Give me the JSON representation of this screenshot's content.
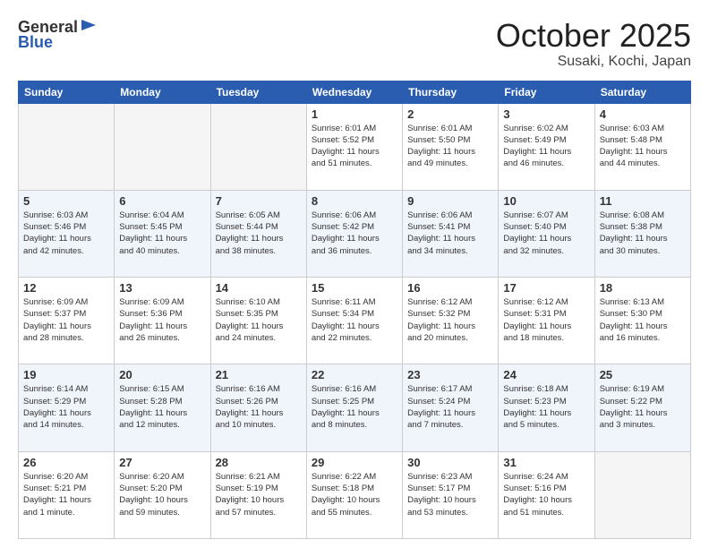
{
  "header": {
    "logo_general": "General",
    "logo_blue": "Blue",
    "month_title": "October 2025",
    "location": "Susaki, Kochi, Japan"
  },
  "weekdays": [
    "Sunday",
    "Monday",
    "Tuesday",
    "Wednesday",
    "Thursday",
    "Friday",
    "Saturday"
  ],
  "weeks": [
    [
      {
        "day": "",
        "info": ""
      },
      {
        "day": "",
        "info": ""
      },
      {
        "day": "",
        "info": ""
      },
      {
        "day": "1",
        "info": "Sunrise: 6:01 AM\nSunset: 5:52 PM\nDaylight: 11 hours\nand 51 minutes."
      },
      {
        "day": "2",
        "info": "Sunrise: 6:01 AM\nSunset: 5:50 PM\nDaylight: 11 hours\nand 49 minutes."
      },
      {
        "day": "3",
        "info": "Sunrise: 6:02 AM\nSunset: 5:49 PM\nDaylight: 11 hours\nand 46 minutes."
      },
      {
        "day": "4",
        "info": "Sunrise: 6:03 AM\nSunset: 5:48 PM\nDaylight: 11 hours\nand 44 minutes."
      }
    ],
    [
      {
        "day": "5",
        "info": "Sunrise: 6:03 AM\nSunset: 5:46 PM\nDaylight: 11 hours\nand 42 minutes."
      },
      {
        "day": "6",
        "info": "Sunrise: 6:04 AM\nSunset: 5:45 PM\nDaylight: 11 hours\nand 40 minutes."
      },
      {
        "day": "7",
        "info": "Sunrise: 6:05 AM\nSunset: 5:44 PM\nDaylight: 11 hours\nand 38 minutes."
      },
      {
        "day": "8",
        "info": "Sunrise: 6:06 AM\nSunset: 5:42 PM\nDaylight: 11 hours\nand 36 minutes."
      },
      {
        "day": "9",
        "info": "Sunrise: 6:06 AM\nSunset: 5:41 PM\nDaylight: 11 hours\nand 34 minutes."
      },
      {
        "day": "10",
        "info": "Sunrise: 6:07 AM\nSunset: 5:40 PM\nDaylight: 11 hours\nand 32 minutes."
      },
      {
        "day": "11",
        "info": "Sunrise: 6:08 AM\nSunset: 5:38 PM\nDaylight: 11 hours\nand 30 minutes."
      }
    ],
    [
      {
        "day": "12",
        "info": "Sunrise: 6:09 AM\nSunset: 5:37 PM\nDaylight: 11 hours\nand 28 minutes."
      },
      {
        "day": "13",
        "info": "Sunrise: 6:09 AM\nSunset: 5:36 PM\nDaylight: 11 hours\nand 26 minutes."
      },
      {
        "day": "14",
        "info": "Sunrise: 6:10 AM\nSunset: 5:35 PM\nDaylight: 11 hours\nand 24 minutes."
      },
      {
        "day": "15",
        "info": "Sunrise: 6:11 AM\nSunset: 5:34 PM\nDaylight: 11 hours\nand 22 minutes."
      },
      {
        "day": "16",
        "info": "Sunrise: 6:12 AM\nSunset: 5:32 PM\nDaylight: 11 hours\nand 20 minutes."
      },
      {
        "day": "17",
        "info": "Sunrise: 6:12 AM\nSunset: 5:31 PM\nDaylight: 11 hours\nand 18 minutes."
      },
      {
        "day": "18",
        "info": "Sunrise: 6:13 AM\nSunset: 5:30 PM\nDaylight: 11 hours\nand 16 minutes."
      }
    ],
    [
      {
        "day": "19",
        "info": "Sunrise: 6:14 AM\nSunset: 5:29 PM\nDaylight: 11 hours\nand 14 minutes."
      },
      {
        "day": "20",
        "info": "Sunrise: 6:15 AM\nSunset: 5:28 PM\nDaylight: 11 hours\nand 12 minutes."
      },
      {
        "day": "21",
        "info": "Sunrise: 6:16 AM\nSunset: 5:26 PM\nDaylight: 11 hours\nand 10 minutes."
      },
      {
        "day": "22",
        "info": "Sunrise: 6:16 AM\nSunset: 5:25 PM\nDaylight: 11 hours\nand 8 minutes."
      },
      {
        "day": "23",
        "info": "Sunrise: 6:17 AM\nSunset: 5:24 PM\nDaylight: 11 hours\nand 7 minutes."
      },
      {
        "day": "24",
        "info": "Sunrise: 6:18 AM\nSunset: 5:23 PM\nDaylight: 11 hours\nand 5 minutes."
      },
      {
        "day": "25",
        "info": "Sunrise: 6:19 AM\nSunset: 5:22 PM\nDaylight: 11 hours\nand 3 minutes."
      }
    ],
    [
      {
        "day": "26",
        "info": "Sunrise: 6:20 AM\nSunset: 5:21 PM\nDaylight: 11 hours\nand 1 minute."
      },
      {
        "day": "27",
        "info": "Sunrise: 6:20 AM\nSunset: 5:20 PM\nDaylight: 10 hours\nand 59 minutes."
      },
      {
        "day": "28",
        "info": "Sunrise: 6:21 AM\nSunset: 5:19 PM\nDaylight: 10 hours\nand 57 minutes."
      },
      {
        "day": "29",
        "info": "Sunrise: 6:22 AM\nSunset: 5:18 PM\nDaylight: 10 hours\nand 55 minutes."
      },
      {
        "day": "30",
        "info": "Sunrise: 6:23 AM\nSunset: 5:17 PM\nDaylight: 10 hours\nand 53 minutes."
      },
      {
        "day": "31",
        "info": "Sunrise: 6:24 AM\nSunset: 5:16 PM\nDaylight: 10 hours\nand 51 minutes."
      },
      {
        "day": "",
        "info": ""
      }
    ]
  ]
}
